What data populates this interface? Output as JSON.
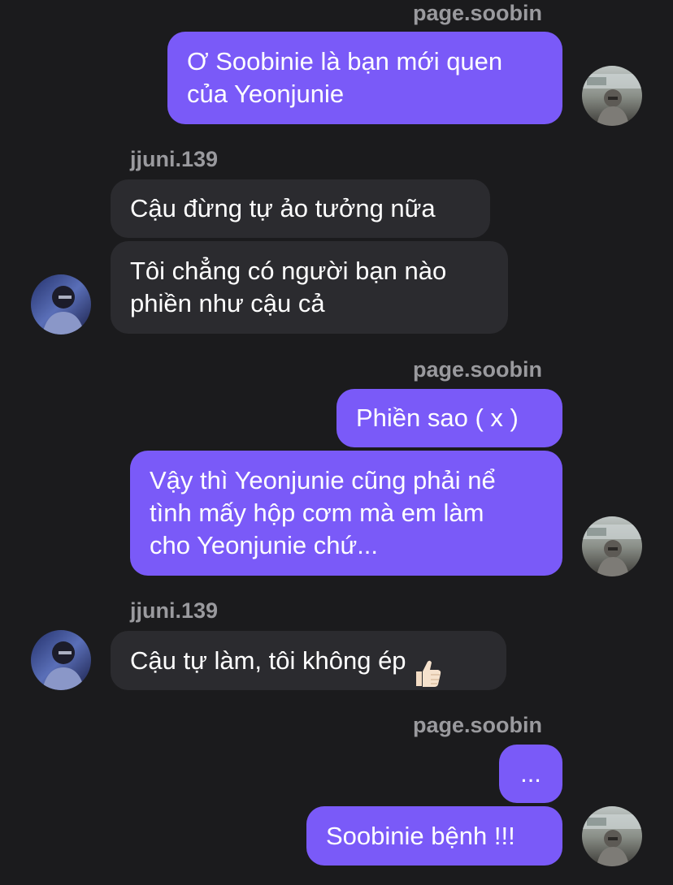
{
  "conversation": {
    "groups": [
      {
        "sender": "page.soobin",
        "side": "right",
        "messages": [
          "Ơ Soobinie là bạn mới quen\ncủa Yeonjunie"
        ]
      },
      {
        "sender": "jjuni.139",
        "side": "left",
        "messages": [
          "Cậu đừng tự ảo tưởng nữa",
          "Tôi chẳng có người bạn nào\nphiền như cậu cả"
        ]
      },
      {
        "sender": "page.soobin",
        "side": "right",
        "messages": [
          "Phiền sao ( x )",
          "Vậy thì Yeonjunie cũng phải nể\ntình mấy hộp cơm mà em làm\ncho Yeonjunie chứ..."
        ]
      },
      {
        "sender": "jjuni.139",
        "side": "left",
        "messages": [
          "Cậu tự làm, tôi không ép"
        ],
        "emoji": "thumbs-up-icon"
      },
      {
        "sender": "page.soobin",
        "side": "right",
        "messages": [
          "...",
          "Soobinie bệnh !!!"
        ]
      }
    ]
  },
  "colors": {
    "background": "#1b1b1d",
    "outgoing_bubble": "#7a5af8",
    "incoming_bubble": "#2b2b2f",
    "sender_text": "#9a9a9e"
  }
}
